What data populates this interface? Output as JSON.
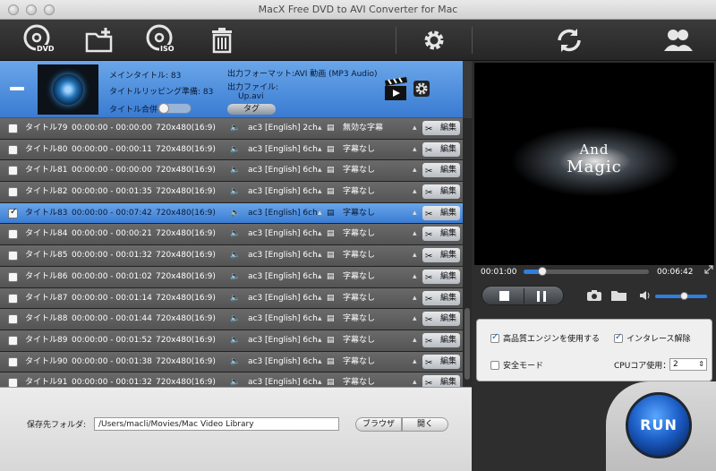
{
  "window": {
    "title": "MacX Free DVD to AVI Converter for Mac"
  },
  "toolbar": {
    "icons": [
      "dvd-disc-icon",
      "add-folder-icon",
      "iso-disc-icon",
      "trash-icon",
      "gear-icon",
      "refresh-icon",
      "users-icon"
    ],
    "dvd_label": "DVD",
    "iso_label": "ISO"
  },
  "selected": {
    "main_title": "メインタイトル: 83",
    "ripping": "タイトルリッピング準備: 83",
    "merge": "タイトル合併",
    "output_format": "出力フォーマット:AVI 動画 (MP3 Audio)",
    "output_file_label": "出力ファイル:",
    "output_file": "Up.avi",
    "tag": "タグ"
  },
  "rows": [
    {
      "title": "タイトル79",
      "range": "00:00:00 - 00:00:00",
      "res": "720x480(16:9)",
      "audio": "ac3 [English] 2ch",
      "sub": "無効な字幕",
      "checked": false,
      "selected": false
    },
    {
      "title": "タイトル80",
      "range": "00:00:00 - 00:00:11",
      "res": "720x480(16:9)",
      "audio": "ac3 [English] 6ch",
      "sub": "字幕なし",
      "checked": false,
      "selected": false
    },
    {
      "title": "タイトル81",
      "range": "00:00:00 - 00:00:00",
      "res": "720x480(16:9)",
      "audio": "ac3 [English] 6ch",
      "sub": "字幕なし",
      "checked": false,
      "selected": false
    },
    {
      "title": "タイトル82",
      "range": "00:00:00 - 00:01:35",
      "res": "720x480(16:9)",
      "audio": "ac3 [English] 6ch",
      "sub": "字幕なし",
      "checked": false,
      "selected": false
    },
    {
      "title": "タイトル83",
      "range": "00:00:00 - 00:07:42",
      "res": "720x480(16:9)",
      "audio": "ac3 [English] 6ch",
      "sub": "字幕なし",
      "checked": true,
      "selected": true
    },
    {
      "title": "タイトル84",
      "range": "00:00:00 - 00:00:21",
      "res": "720x480(16:9)",
      "audio": "ac3 [English] 6ch",
      "sub": "字幕なし",
      "checked": false,
      "selected": false
    },
    {
      "title": "タイトル85",
      "range": "00:00:00 - 00:01:32",
      "res": "720x480(16:9)",
      "audio": "ac3 [English] 6ch",
      "sub": "字幕なし",
      "checked": false,
      "selected": false
    },
    {
      "title": "タイトル86",
      "range": "00:00:00 - 00:01:02",
      "res": "720x480(16:9)",
      "audio": "ac3 [English] 6ch",
      "sub": "字幕なし",
      "checked": false,
      "selected": false
    },
    {
      "title": "タイトル87",
      "range": "00:00:00 - 00:01:14",
      "res": "720x480(16:9)",
      "audio": "ac3 [English] 6ch",
      "sub": "字幕なし",
      "checked": false,
      "selected": false
    },
    {
      "title": "タイトル88",
      "range": "00:00:00 - 00:01:44",
      "res": "720x480(16:9)",
      "audio": "ac3 [English] 6ch",
      "sub": "字幕なし",
      "checked": false,
      "selected": false
    },
    {
      "title": "タイトル89",
      "range": "00:00:00 - 00:01:52",
      "res": "720x480(16:9)",
      "audio": "ac3 [English] 6ch",
      "sub": "字幕なし",
      "checked": false,
      "selected": false
    },
    {
      "title": "タイトル90",
      "range": "00:00:00 - 00:01:38",
      "res": "720x480(16:9)",
      "audio": "ac3 [English] 6ch",
      "sub": "字幕なし",
      "checked": false,
      "selected": false
    },
    {
      "title": "タイトル91",
      "range": "00:00:00 - 00:01:32",
      "res": "720x480(16:9)",
      "audio": "ac3 [English] 6ch",
      "sub": "字幕なし",
      "checked": false,
      "selected": false
    }
  ],
  "row_edit_label": "編集",
  "bottom": {
    "dest_label": "保存先フォルダ:",
    "dest_value": "/Users/macli/Movies/Mac Video Library",
    "browse": "ブラウザ",
    "open": "開く"
  },
  "player": {
    "logo_line1": "And",
    "logo_line2": "Magic",
    "current_time": "00:01:00",
    "total_time": "00:06:42",
    "progress": 0.149,
    "volume": 0.55
  },
  "settings": {
    "hq_engine": "高品質エンジンを使用する",
    "hq_checked": true,
    "deinterlace": "インタレース解除",
    "deinterlace_checked": true,
    "safe_mode": "安全モード",
    "safe_checked": false,
    "cpu_label": "CPUコア使用：",
    "cpu_value": "2"
  },
  "run_label": "RUN"
}
